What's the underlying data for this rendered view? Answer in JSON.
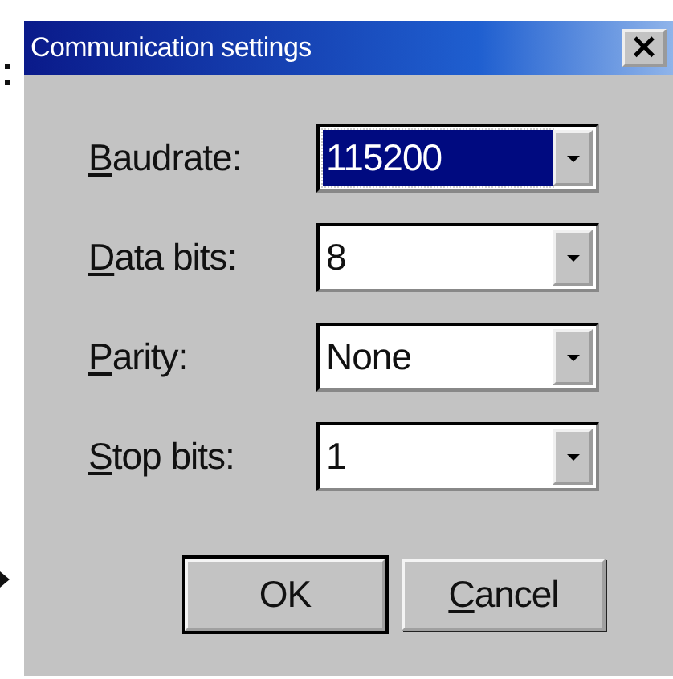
{
  "window": {
    "title": "Communication settings",
    "close": "×"
  },
  "fields": [
    {
      "label_key": "B",
      "label_rest": "audrate:",
      "value": "115200",
      "focused": true
    },
    {
      "label_key": "D",
      "label_rest": "ata bits:",
      "value": "8",
      "focused": false
    },
    {
      "label_key": "P",
      "label_rest": "arity:",
      "value": "None",
      "focused": false
    },
    {
      "label_key": "S",
      "label_rest": "top bits:",
      "value": "1",
      "focused": false
    }
  ],
  "buttons": [
    {
      "label": "OK",
      "default": true
    },
    {
      "key": "C",
      "label": "ancel",
      "default": false
    }
  ]
}
